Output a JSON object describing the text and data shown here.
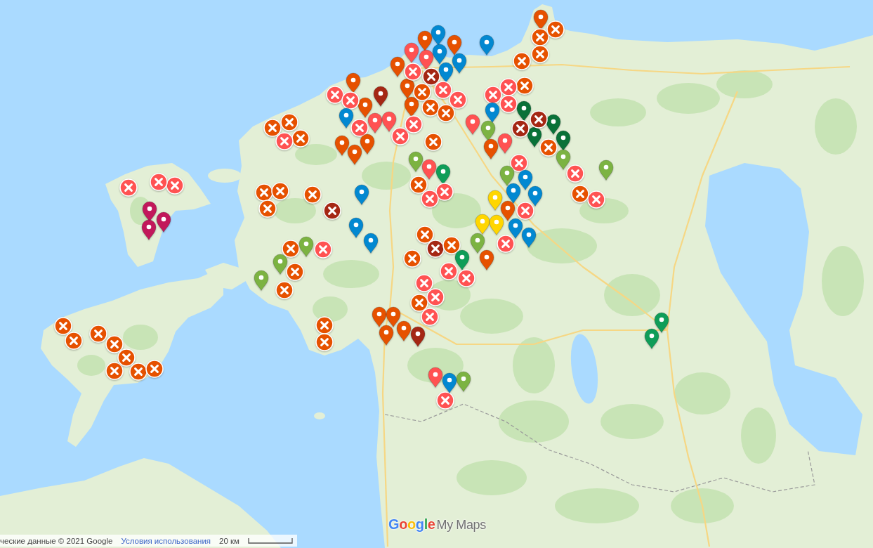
{
  "map": {
    "markers": [
      {
        "kind": "pin",
        "color": "#0288d1"
      },
      {
        "kind": "pin",
        "color": "#e65100"
      },
      {
        "kind": "pin",
        "color": "#0288d1"
      },
      {
        "kind": "pin",
        "color": "#e65100"
      },
      {
        "kind": "pin",
        "color": "#e65100"
      },
      {
        "kind": "pin",
        "color": "#ff5252"
      },
      {
        "kind": "pin",
        "color": "#ff5252"
      },
      {
        "kind": "pin",
        "color": "#0288d1"
      },
      {
        "kind": "pin",
        "color": "#0288d1"
      },
      {
        "kind": "pin",
        "color": "#0288d1"
      },
      {
        "kind": "pin",
        "color": "#e65100"
      },
      {
        "kind": "pin",
        "color": "#e65100"
      },
      {
        "kind": "cross",
        "color": "#ff5252"
      },
      {
        "kind": "cross",
        "color": "#a52714"
      },
      {
        "kind": "cross",
        "color": "#e65100"
      },
      {
        "kind": "cross",
        "color": "#e65100"
      },
      {
        "kind": "cross",
        "color": "#e65100"
      },
      {
        "kind": "cross",
        "color": "#ff5252"
      },
      {
        "kind": "cross",
        "color": "#ff5252"
      },
      {
        "kind": "pin",
        "color": "#e65100"
      },
      {
        "kind": "pin",
        "color": "#e65100"
      },
      {
        "kind": "cross",
        "color": "#ff5252"
      },
      {
        "kind": "cross",
        "color": "#ff5252"
      },
      {
        "kind": "cross",
        "color": "#ff5252"
      },
      {
        "kind": "pin",
        "color": "#0288d1"
      },
      {
        "kind": "pin",
        "color": "#a52714"
      },
      {
        "kind": "pin",
        "color": "#ff5252"
      },
      {
        "kind": "pin",
        "color": "#ff5252"
      },
      {
        "kind": "cross",
        "color": "#ff5252"
      },
      {
        "kind": "cross",
        "color": "#ff5252"
      },
      {
        "kind": "cross",
        "color": "#e65100"
      },
      {
        "kind": "cross",
        "color": "#e65100"
      },
      {
        "kind": "cross",
        "color": "#e65100"
      },
      {
        "kind": "cross",
        "color": "#ff5252"
      },
      {
        "kind": "pin",
        "color": "#e65100"
      },
      {
        "kind": "pin",
        "color": "#e65100"
      },
      {
        "kind": "pin",
        "color": "#e65100"
      },
      {
        "kind": "cross",
        "color": "#e65100"
      },
      {
        "kind": "pin",
        "color": "#ff5252"
      },
      {
        "kind": "cross",
        "color": "#e65100"
      },
      {
        "kind": "cross",
        "color": "#ff5252"
      },
      {
        "kind": "cross",
        "color": "#ff5252"
      },
      {
        "kind": "cross",
        "color": "#ff5252"
      },
      {
        "kind": "pin",
        "color": "#0288d1"
      },
      {
        "kind": "pin",
        "color": "#ff5252"
      },
      {
        "kind": "pin",
        "color": "#7cb342"
      },
      {
        "kind": "pin",
        "color": "#e65100"
      },
      {
        "kind": "pin",
        "color": "#e65100"
      },
      {
        "kind": "cross",
        "color": "#e65100"
      },
      {
        "kind": "cross",
        "color": "#e65100"
      },
      {
        "kind": "cross",
        "color": "#e65100"
      },
      {
        "kind": "cross",
        "color": "#e65100"
      },
      {
        "kind": "pin",
        "color": "#097138"
      },
      {
        "kind": "pin",
        "color": "#097138"
      },
      {
        "kind": "pin",
        "color": "#097138"
      },
      {
        "kind": "pin",
        "color": "#097138"
      },
      {
        "kind": "cross",
        "color": "#a52714"
      },
      {
        "kind": "cross",
        "color": "#a52714"
      },
      {
        "kind": "cross",
        "color": "#e65100"
      },
      {
        "kind": "pin",
        "color": "#7cb342"
      },
      {
        "kind": "pin",
        "color": "#7cb342"
      },
      {
        "kind": "cross",
        "color": "#ff5252"
      },
      {
        "kind": "cross",
        "color": "#ff5252"
      },
      {
        "kind": "cross",
        "color": "#e65100"
      },
      {
        "kind": "cross",
        "color": "#ff5252"
      },
      {
        "kind": "pin",
        "color": "#7cb342"
      },
      {
        "kind": "pin",
        "color": "#0288d1"
      },
      {
        "kind": "cross",
        "color": "#ff5252"
      },
      {
        "kind": "pin",
        "color": "#0288d1"
      },
      {
        "kind": "pin",
        "color": "#0288d1"
      },
      {
        "kind": "pin",
        "color": "#e65100"
      },
      {
        "kind": "pin",
        "color": "#ffd600"
      },
      {
        "kind": "pin",
        "color": "#ffd600"
      },
      {
        "kind": "pin",
        "color": "#ffd600"
      },
      {
        "kind": "pin",
        "color": "#0288d1"
      },
      {
        "kind": "cross",
        "color": "#ff5252"
      },
      {
        "kind": "pin",
        "color": "#0288d1"
      },
      {
        "kind": "pin",
        "color": "#7cb342"
      },
      {
        "kind": "pin",
        "color": "#ff5252"
      },
      {
        "kind": "pin",
        "color": "#0f9d58"
      },
      {
        "kind": "cross",
        "color": "#e65100"
      },
      {
        "kind": "cross",
        "color": "#ff5252"
      },
      {
        "kind": "cross",
        "color": "#ff5252"
      },
      {
        "kind": "cross",
        "color": "#e65100"
      },
      {
        "kind": "cross",
        "color": "#e65100"
      },
      {
        "kind": "cross",
        "color": "#e65100"
      },
      {
        "kind": "cross",
        "color": "#e65100"
      },
      {
        "kind": "cross",
        "color": "#a52714"
      },
      {
        "kind": "pin",
        "color": "#0288d1"
      },
      {
        "kind": "pin",
        "color": "#0288d1"
      },
      {
        "kind": "pin",
        "color": "#0288d1"
      },
      {
        "kind": "cross",
        "color": "#ff5252"
      },
      {
        "kind": "cross",
        "color": "#e65100"
      },
      {
        "kind": "pin",
        "color": "#7cb342"
      },
      {
        "kind": "cross",
        "color": "#e65100"
      },
      {
        "kind": "pin",
        "color": "#7cb342"
      },
      {
        "kind": "pin",
        "color": "#7cb342"
      },
      {
        "kind": "cross",
        "color": "#e65100"
      },
      {
        "kind": "cross",
        "color": "#e65100"
      },
      {
        "kind": "cross",
        "color": "#a52714"
      },
      {
        "kind": "cross",
        "color": "#e65100"
      },
      {
        "kind": "cross",
        "color": "#ff5252"
      },
      {
        "kind": "pin",
        "color": "#0f9d58"
      },
      {
        "kind": "cross",
        "color": "#ff5252"
      },
      {
        "kind": "cross",
        "color": "#e65100"
      },
      {
        "kind": "pin",
        "color": "#7cb342"
      },
      {
        "kind": "pin",
        "color": "#e65100"
      },
      {
        "kind": "cross",
        "color": "#ff5252"
      },
      {
        "kind": "cross",
        "color": "#e65100"
      },
      {
        "kind": "cross",
        "color": "#ff5252"
      },
      {
        "kind": "cross",
        "color": "#ff5252"
      },
      {
        "kind": "cross",
        "color": "#e65100"
      },
      {
        "kind": "cross",
        "color": "#e65100"
      },
      {
        "kind": "pin",
        "color": "#e65100"
      },
      {
        "kind": "pin",
        "color": "#e65100"
      },
      {
        "kind": "pin",
        "color": "#e65100"
      },
      {
        "kind": "pin",
        "color": "#e65100"
      },
      {
        "kind": "pin",
        "color": "#a52714"
      },
      {
        "kind": "pin",
        "color": "#ff5252"
      },
      {
        "kind": "cross",
        "color": "#ff5252"
      },
      {
        "kind": "pin",
        "color": "#7cb342"
      },
      {
        "kind": "pin",
        "color": "#0288d1"
      },
      {
        "kind": "pin",
        "color": "#0f9d58"
      },
      {
        "kind": "pin",
        "color": "#0f9d58"
      },
      {
        "kind": "cross",
        "color": "#ff5252"
      },
      {
        "kind": "cross",
        "color": "#ff5252"
      },
      {
        "kind": "cross",
        "color": "#ff5252"
      },
      {
        "kind": "pin",
        "color": "#c2185b"
      },
      {
        "kind": "pin",
        "color": "#c2185b"
      },
      {
        "kind": "pin",
        "color": "#c2185b"
      },
      {
        "kind": "cross",
        "color": "#e65100"
      },
      {
        "kind": "cross",
        "color": "#e65100"
      },
      {
        "kind": "cross",
        "color": "#e65100"
      },
      {
        "kind": "cross",
        "color": "#e65100"
      },
      {
        "kind": "cross",
        "color": "#e65100"
      },
      {
        "kind": "cross",
        "color": "#e65100"
      },
      {
        "kind": "cross",
        "color": "#e65100"
      },
      {
        "kind": "cross",
        "color": "#e65100"
      }
    ]
  },
  "logo": {
    "brand": "Google",
    "product": "My Maps"
  },
  "attribution": {
    "map_data": "ческие данные © 2021 Google",
    "terms_link": "Условия использования",
    "scale": "20 км"
  }
}
